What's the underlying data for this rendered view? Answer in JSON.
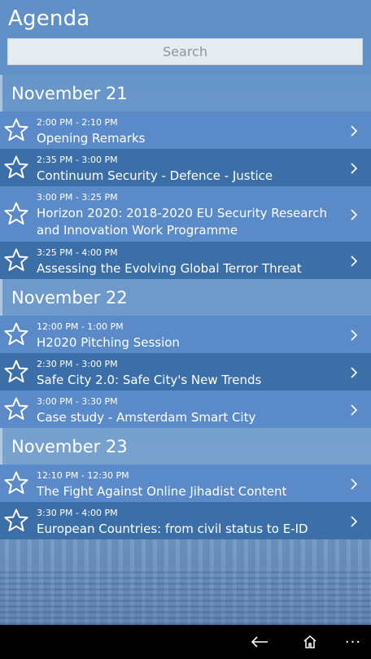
{
  "app": {
    "title": "Agenda"
  },
  "search": {
    "placeholder": "Search"
  },
  "days": [
    {
      "date": "November 21",
      "sessions": [
        {
          "time": "2:00 PM - 2:10 PM",
          "title": "Opening Remarks"
        },
        {
          "time": "2:35 PM - 3:00 PM",
          "title": "Continuum Security - Defence - Justice"
        },
        {
          "time": "3:00 PM - 3:25 PM",
          "title": "Horizon 2020: 2018-2020 EU Security Research and Innovation Work Programme"
        },
        {
          "time": "3:25 PM - 4:00 PM",
          "title": "Assessing the Evolving Global Terror Threat"
        }
      ]
    },
    {
      "date": "November 22",
      "sessions": [
        {
          "time": "12:00 PM - 1:00 PM",
          "title": "H2020 Pitching Session"
        },
        {
          "time": "2:30 PM - 3:00 PM",
          "title": "Safe City 2.0: Safe City's New Trends"
        },
        {
          "time": "3:00 PM - 3:30 PM",
          "title": "Case study - Amsterdam Smart City"
        }
      ]
    },
    {
      "date": "November 23",
      "sessions": [
        {
          "time": "12:10 PM - 12:30 PM",
          "title": "The Fight Against Online Jihadist Content"
        },
        {
          "time": "3:30 PM - 4:00 PM",
          "title": "European Countries: from civil status to E-ID"
        }
      ]
    }
  ],
  "navbar": {
    "more_label": "···"
  },
  "icons": {
    "favorite": "star-outline-icon",
    "open": "chevron-right-icon",
    "back": "back-arrow-icon",
    "home": "home-icon"
  },
  "colors": {
    "row_light": "#5a8bc8",
    "row_dark": "#3c6fa8",
    "background": "#6b98cb"
  }
}
